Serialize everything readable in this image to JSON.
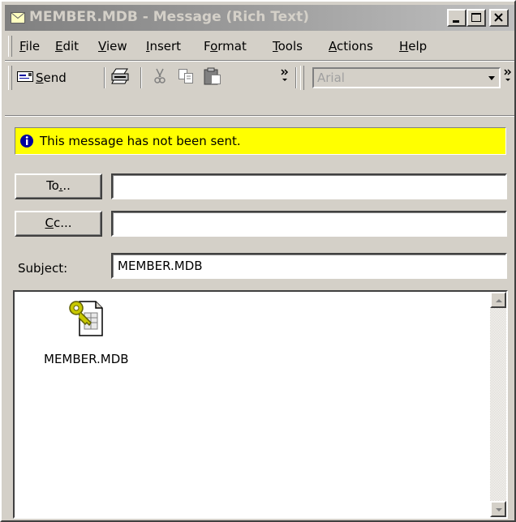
{
  "window": {
    "title": "MEMBER.MDB - Message (Rich Text)"
  },
  "menu": {
    "items": [
      {
        "acc": "F",
        "rest": "ile"
      },
      {
        "acc": "E",
        "rest": "dit"
      },
      {
        "acc": "V",
        "rest": "iew"
      },
      {
        "acc": "I",
        "rest": "nsert"
      },
      {
        "pre": "F",
        "acc": "o",
        "rest": "rmat"
      },
      {
        "acc": "T",
        "rest": "ools"
      },
      {
        "acc": "A",
        "rest": "ctions"
      },
      {
        "acc": "H",
        "rest": "elp"
      }
    ]
  },
  "toolbar": {
    "send_pre": "",
    "send_acc": "S",
    "send_rest": "end",
    "font_value": "Arial",
    "icons": [
      "envelope-send-icon",
      "print-icon",
      "cut-icon",
      "copy-icon",
      "paste-icon"
    ]
  },
  "info": {
    "text": "This message has not been sent."
  },
  "fields": {
    "to_button": {
      "pre": "To",
      "acc": ".",
      "rest": ".."
    },
    "cc_button": {
      "pre": "",
      "acc": "C",
      "rest": "c..."
    },
    "to_value": "",
    "cc_value": "",
    "subject_label": "Subject:",
    "subject_value": "MEMBER.MDB"
  },
  "body": {
    "attachment_name": "MEMBER.MDB"
  },
  "colors": {
    "info_background": "#ffff00",
    "face": "#d4d0c8"
  }
}
